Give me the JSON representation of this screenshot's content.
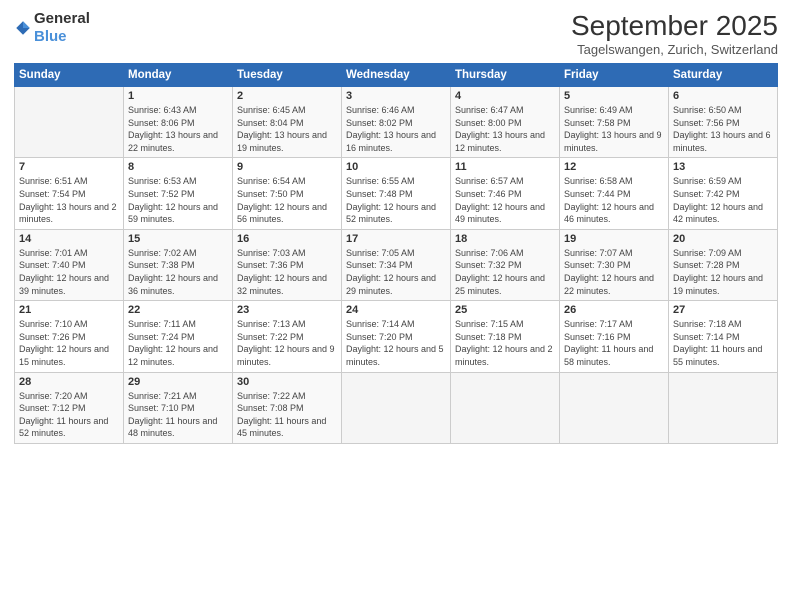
{
  "header": {
    "logo_general": "General",
    "logo_blue": "Blue",
    "title": "September 2025",
    "location": "Tagelswangen, Zurich, Switzerland"
  },
  "days_of_week": [
    "Sunday",
    "Monday",
    "Tuesday",
    "Wednesday",
    "Thursday",
    "Friday",
    "Saturday"
  ],
  "weeks": [
    [
      {
        "day": "",
        "info": ""
      },
      {
        "day": "1",
        "info": "Sunrise: 6:43 AM\nSunset: 8:06 PM\nDaylight: 13 hours and 22 minutes."
      },
      {
        "day": "2",
        "info": "Sunrise: 6:45 AM\nSunset: 8:04 PM\nDaylight: 13 hours and 19 minutes."
      },
      {
        "day": "3",
        "info": "Sunrise: 6:46 AM\nSunset: 8:02 PM\nDaylight: 13 hours and 16 minutes."
      },
      {
        "day": "4",
        "info": "Sunrise: 6:47 AM\nSunset: 8:00 PM\nDaylight: 13 hours and 12 minutes."
      },
      {
        "day": "5",
        "info": "Sunrise: 6:49 AM\nSunset: 7:58 PM\nDaylight: 13 hours and 9 minutes."
      },
      {
        "day": "6",
        "info": "Sunrise: 6:50 AM\nSunset: 7:56 PM\nDaylight: 13 hours and 6 minutes."
      }
    ],
    [
      {
        "day": "7",
        "info": "Sunrise: 6:51 AM\nSunset: 7:54 PM\nDaylight: 13 hours and 2 minutes."
      },
      {
        "day": "8",
        "info": "Sunrise: 6:53 AM\nSunset: 7:52 PM\nDaylight: 12 hours and 59 minutes."
      },
      {
        "day": "9",
        "info": "Sunrise: 6:54 AM\nSunset: 7:50 PM\nDaylight: 12 hours and 56 minutes."
      },
      {
        "day": "10",
        "info": "Sunrise: 6:55 AM\nSunset: 7:48 PM\nDaylight: 12 hours and 52 minutes."
      },
      {
        "day": "11",
        "info": "Sunrise: 6:57 AM\nSunset: 7:46 PM\nDaylight: 12 hours and 49 minutes."
      },
      {
        "day": "12",
        "info": "Sunrise: 6:58 AM\nSunset: 7:44 PM\nDaylight: 12 hours and 46 minutes."
      },
      {
        "day": "13",
        "info": "Sunrise: 6:59 AM\nSunset: 7:42 PM\nDaylight: 12 hours and 42 minutes."
      }
    ],
    [
      {
        "day": "14",
        "info": "Sunrise: 7:01 AM\nSunset: 7:40 PM\nDaylight: 12 hours and 39 minutes."
      },
      {
        "day": "15",
        "info": "Sunrise: 7:02 AM\nSunset: 7:38 PM\nDaylight: 12 hours and 36 minutes."
      },
      {
        "day": "16",
        "info": "Sunrise: 7:03 AM\nSunset: 7:36 PM\nDaylight: 12 hours and 32 minutes."
      },
      {
        "day": "17",
        "info": "Sunrise: 7:05 AM\nSunset: 7:34 PM\nDaylight: 12 hours and 29 minutes."
      },
      {
        "day": "18",
        "info": "Sunrise: 7:06 AM\nSunset: 7:32 PM\nDaylight: 12 hours and 25 minutes."
      },
      {
        "day": "19",
        "info": "Sunrise: 7:07 AM\nSunset: 7:30 PM\nDaylight: 12 hours and 22 minutes."
      },
      {
        "day": "20",
        "info": "Sunrise: 7:09 AM\nSunset: 7:28 PM\nDaylight: 12 hours and 19 minutes."
      }
    ],
    [
      {
        "day": "21",
        "info": "Sunrise: 7:10 AM\nSunset: 7:26 PM\nDaylight: 12 hours and 15 minutes."
      },
      {
        "day": "22",
        "info": "Sunrise: 7:11 AM\nSunset: 7:24 PM\nDaylight: 12 hours and 12 minutes."
      },
      {
        "day": "23",
        "info": "Sunrise: 7:13 AM\nSunset: 7:22 PM\nDaylight: 12 hours and 9 minutes."
      },
      {
        "day": "24",
        "info": "Sunrise: 7:14 AM\nSunset: 7:20 PM\nDaylight: 12 hours and 5 minutes."
      },
      {
        "day": "25",
        "info": "Sunrise: 7:15 AM\nSunset: 7:18 PM\nDaylight: 12 hours and 2 minutes."
      },
      {
        "day": "26",
        "info": "Sunrise: 7:17 AM\nSunset: 7:16 PM\nDaylight: 11 hours and 58 minutes."
      },
      {
        "day": "27",
        "info": "Sunrise: 7:18 AM\nSunset: 7:14 PM\nDaylight: 11 hours and 55 minutes."
      }
    ],
    [
      {
        "day": "28",
        "info": "Sunrise: 7:20 AM\nSunset: 7:12 PM\nDaylight: 11 hours and 52 minutes."
      },
      {
        "day": "29",
        "info": "Sunrise: 7:21 AM\nSunset: 7:10 PM\nDaylight: 11 hours and 48 minutes."
      },
      {
        "day": "30",
        "info": "Sunrise: 7:22 AM\nSunset: 7:08 PM\nDaylight: 11 hours and 45 minutes."
      },
      {
        "day": "",
        "info": ""
      },
      {
        "day": "",
        "info": ""
      },
      {
        "day": "",
        "info": ""
      },
      {
        "day": "",
        "info": ""
      }
    ]
  ]
}
